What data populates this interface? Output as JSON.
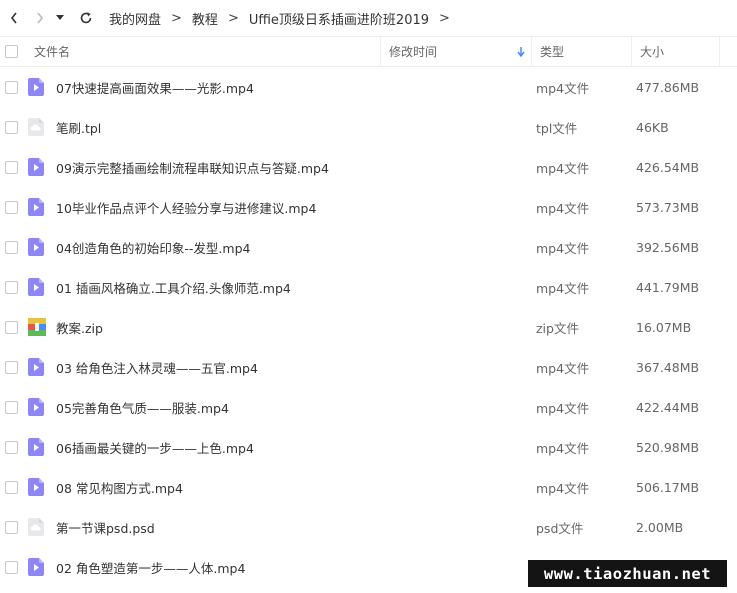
{
  "breadcrumb": [
    "我的网盘",
    "教程",
    "Uffie顶级日系插画进阶班2019"
  ],
  "breadcrumb_separator": ">",
  "columns": {
    "name": "文件名",
    "modified": "修改时间",
    "type": "类型",
    "size": "大小"
  },
  "files": [
    {
      "name": "07快速提高画面效果——光影.mp4",
      "type": "mp4文件",
      "size": "477.86MB",
      "icon": "video-file-icon"
    },
    {
      "name": "笔刷.tpl",
      "type": "tpl文件",
      "size": "46KB",
      "icon": "cloud-file-icon"
    },
    {
      "name": "09演示完整插画绘制流程串联知识点与答疑.mp4",
      "type": "mp4文件",
      "size": "426.54MB",
      "icon": "video-file-icon"
    },
    {
      "name": "10毕业作品点评个人经验分享与进修建议.mp4",
      "type": "mp4文件",
      "size": "573.73MB",
      "icon": "video-file-icon"
    },
    {
      "name": "04创造角色的初始印象--发型.mp4",
      "type": "mp4文件",
      "size": "392.56MB",
      "icon": "video-file-icon"
    },
    {
      "name": "01 插画风格确立.工具介绍.头像师范.mp4",
      "type": "mp4文件",
      "size": "441.79MB",
      "icon": "video-file-icon"
    },
    {
      "name": "教案.zip",
      "type": "zip文件",
      "size": "16.07MB",
      "icon": "zip-file-icon"
    },
    {
      "name": "03 给角色注入林灵魂——五官.mp4",
      "type": "mp4文件",
      "size": "367.48MB",
      "icon": "video-file-icon"
    },
    {
      "name": "05完善角色气质——服装.mp4",
      "type": "mp4文件",
      "size": "422.44MB",
      "icon": "video-file-icon"
    },
    {
      "name": "06插画最关键的一步——上色.mp4",
      "type": "mp4文件",
      "size": "520.98MB",
      "icon": "video-file-icon"
    },
    {
      "name": "08 常见构图方式.mp4",
      "type": "mp4文件",
      "size": "506.17MB",
      "icon": "video-file-icon"
    },
    {
      "name": "第一节课psd.psd",
      "type": "psd文件",
      "size": "2.00MB",
      "icon": "cloud-file-icon"
    },
    {
      "name": "02 角色塑造第一步——人体.mp4",
      "type": "",
      "size": "",
      "icon": "video-file-icon"
    }
  ],
  "watermark": "www.tiaozhuan.net",
  "colors": {
    "video_icon": "#8f86f5",
    "cloud_icon": "#cfd3da",
    "sort_arrow": "#4a8bf5"
  }
}
